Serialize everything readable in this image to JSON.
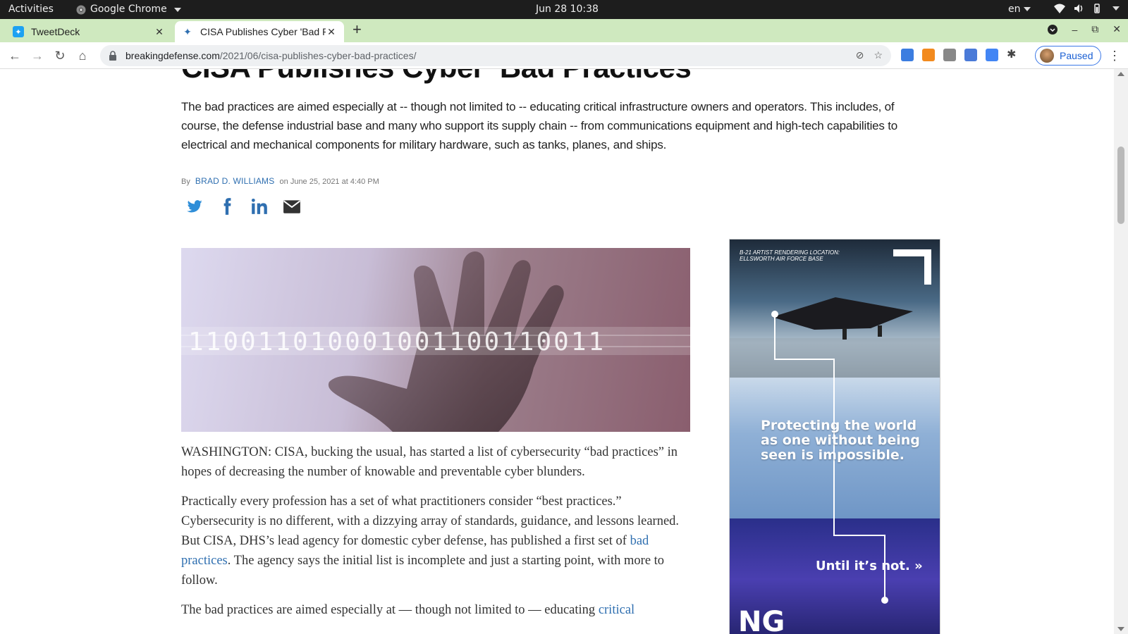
{
  "system_bar": {
    "activities": "Activities",
    "app_name": "Google Chrome",
    "clock": "Jun 28  10:38",
    "language": "en"
  },
  "tabs": [
    {
      "title": "TweetDeck",
      "favicon": "twitter-icon",
      "active": false
    },
    {
      "title": "CISA Publishes Cyber 'Bad Practices'",
      "favicon": "site-icon",
      "active": true
    }
  ],
  "omnibox": {
    "domain": "breakingdefense.com",
    "path": "/2021/06/cisa-publishes-cyber-bad-practices/"
  },
  "profile": {
    "label": "Paused"
  },
  "article": {
    "title": "CISA Publishes Cyber ‘Bad Practices’",
    "dek": "The bad practices are aimed especially at -- though not limited to -- educating critical infrastructure owners and operators. This includes, of course, the defense industrial base and many who support its supply chain -- from communications equipment and high-tech capabilities to electrical and mechanical components for military hardware, such as tanks, planes, and ships.",
    "byline_prefix": "By",
    "author": "Brad D. Williams",
    "date": "on June 25, 2021 at 4:40 PM",
    "paragraph1": "WASHINGTON: CISA, bucking the usual, has started a list of cybersecurity “bad practices” in hopes of decreasing the number of knowable and preventable cyber blunders.",
    "paragraph2_a": "Practically every profession has a set of what practitioners consider “best practices.” Cybersecurity is no different, with a dizzying array of standards, guidance, and lessons learned. But CISA, DHS’s lead agency for domestic cyber defense, has published a first set of ",
    "paragraph2_link": "bad practices",
    "paragraph2_b": ". The agency says the initial list is incomplete and just a starting point, with more to follow.",
    "paragraph3_a": "The bad practices are aimed especially at — though not limited to — educating ",
    "paragraph3_link": "critical"
  },
  "hero_image": {
    "binary_text": "110011010001001100110011"
  },
  "ad": {
    "caption": "B-21 artist rendering location: Ellsworth Air Force Base",
    "headline": "Protecting the world as one without being seen is impossible.",
    "cta": "Until it’s not. »",
    "logo": "NG"
  },
  "colors": {
    "link": "#2f6fb0",
    "tabstrip": "#cfe9bf",
    "profile": "#1a5fd3"
  }
}
